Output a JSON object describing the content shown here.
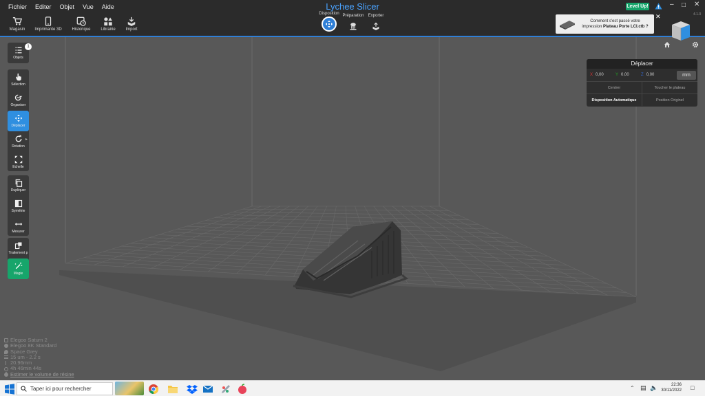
{
  "app": {
    "title": "Lychee Slicer",
    "version": "4.1.0"
  },
  "menu": [
    "Fichier",
    "Editer",
    "Objet",
    "Vue",
    "Aide"
  ],
  "toolbar": [
    {
      "label": "Magasin",
      "icon": "cart-icon"
    },
    {
      "label": "Imprimante 3D",
      "icon": "phone-icon"
    },
    {
      "label": "Historique",
      "icon": "history-icon"
    },
    {
      "label": "Librairie",
      "icon": "shapes-icon"
    },
    {
      "label": "Import",
      "icon": "import-icon"
    }
  ],
  "workflow": [
    {
      "label": "Disposition",
      "active": true
    },
    {
      "label": "Préparation",
      "active": false
    },
    {
      "label": "Exporter",
      "active": false
    }
  ],
  "header": {
    "level_up": "Level Up!"
  },
  "notification": {
    "line1": "Comment s'est passé votre",
    "line2_prefix": "impression",
    "line2_bold": "Plateau Porte LCI.ctb ?"
  },
  "sidebar": {
    "objects_label": "Objets",
    "objects_count": "1",
    "tools": [
      "Sélection",
      "Organiser",
      "Déplacer",
      "Rotation",
      "Echelle",
      "Dupliquer",
      "Symétrie",
      "Mesurer",
      "Traitement p",
      "Magie"
    ]
  },
  "move_panel": {
    "title": "Déplacer",
    "x": "0,00",
    "y": "0,00",
    "z": "0,00",
    "x_label": "X",
    "y_label": "Y",
    "z_label": "Z",
    "unit": "mm",
    "btn_center": "Centrer",
    "btn_touch": "Toucher le plateau",
    "btn_auto": "Disposition Automatique",
    "btn_origin": "Position Originel"
  },
  "info": {
    "printer": "Elegoo Saturn 2",
    "resin": "Elegoo 8K Standard",
    "color": "Space Grey",
    "layer": "15 um - 2.2 s",
    "height": "20.96mm",
    "time": "4h 46min 44s",
    "estimate_link": "Estimer le volume de résine"
  },
  "taskbar": {
    "search_placeholder": "Taper ici pour rechercher",
    "time": "22:36",
    "date": "30/11/2022"
  },
  "colors": {
    "accent": "#2f7fd6",
    "levelup": "#17a56b",
    "magic": "#17a56b"
  }
}
